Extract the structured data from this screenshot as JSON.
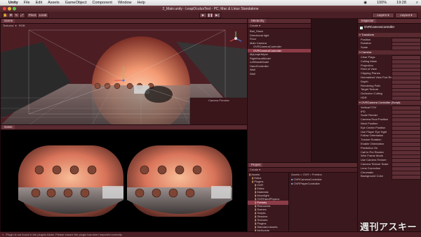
{
  "menubar": {
    "items": [
      "Unity",
      "File",
      "Edit",
      "Assets",
      "GameObject",
      "Component",
      "Window",
      "Help"
    ],
    "clock": "19:28",
    "battery": "100%"
  },
  "window": {
    "title": "2_Main.unity - LeapOculusTest - PC, Mac & Linux Standalone"
  },
  "toolbar": {
    "play_icon": "play-icon",
    "pause_icon": "pause-icon",
    "step_icon": "step-icon",
    "layers_label": "Layers",
    "layout_label": "Layout"
  },
  "scene": {
    "tab": "Scene",
    "shading": "Textured",
    "mode": "RGB",
    "camera_preview_label": "Camera Preview"
  },
  "game": {
    "tab": "Game"
  },
  "hierarchy": {
    "tab": "Hierarchy",
    "create_label": "Create",
    "items": [
      {
        "label": "Ball_Stack",
        "indent": 0,
        "selected": false
      },
      {
        "label": "Directional light",
        "indent": 0,
        "selected": false
      },
      {
        "label": "Floor",
        "indent": 0,
        "selected": false
      },
      {
        "label": "Main Camera",
        "indent": 0,
        "selected": false
      },
      {
        "label": "OVRCameraController",
        "indent": 1,
        "selected": false
      },
      {
        "label": "OVRCameraController",
        "indent": 1,
        "selected": true
      },
      {
        "label": "MyLeapHelper",
        "indent": 0,
        "selected": false
      },
      {
        "label": "RightHandModel",
        "indent": 0,
        "selected": false
      },
      {
        "label": "LeftHandModel",
        "indent": 0,
        "selected": false
      },
      {
        "label": "HandController",
        "indent": 0,
        "selected": false
      },
      {
        "label": "Wall",
        "indent": 0,
        "selected": false
      },
      {
        "label": "Wall",
        "indent": 0,
        "selected": false
      }
    ]
  },
  "inspector": {
    "tab": "Inspector",
    "object_name": "OVRCameraController",
    "sections": [
      {
        "title": "Transform",
        "rows": [
          "Position",
          "Rotation",
          "Scale"
        ]
      },
      {
        "title": "Camera",
        "rows": [
          "Clear Flags",
          "Culling Mask",
          "Projection",
          "Field of View",
          "Clipping Planes",
          "Normalized View Port Rect",
          "Depth",
          "Rendering Path",
          "Target Texture",
          "Occlusion Culling",
          "HDR"
        ]
      },
      {
        "title": "OVRCamera Controller (Script)",
        "rows": [
          "Vertical FOV",
          "IPD",
          "Scale Render",
          "Camera Root Position",
          "Neck Position",
          "Eye Center Position",
          "Use Player Eye Hght",
          "Follow Orientation",
          "Tracker Rotation",
          "Enable Orientation",
          "Prediction On",
          "Call In Pre Render",
          "Wire Frame Mode",
          "Use Camera Texture",
          "Camera Texture Scale",
          "Lens Correction",
          "Chromatic",
          "Background Color"
        ]
      }
    ]
  },
  "project": {
    "tab": "Project",
    "create_label": "Create",
    "breadcrumb": "Assets > OVR > Prefabs",
    "folders": [
      "Assets",
      "Editor",
      "Plugins",
      "OVR",
      "Editor",
      "Materials",
      "Moonlight",
      "OVRHandPhysics",
      "Prefabs",
      "Resources",
      "Scenes",
      "Scripts",
      "Shaders",
      "Textures",
      "Plugins",
      "Standard Assets",
      "MyScripts"
    ],
    "files": [
      "OVRCameraController",
      "OVRPlayerController"
    ]
  },
  "status": {
    "message": "Plugin is not found in the plugins folder. Please ensure the plugin has been imported correctly."
  },
  "watermark": "週刊アスキー"
}
